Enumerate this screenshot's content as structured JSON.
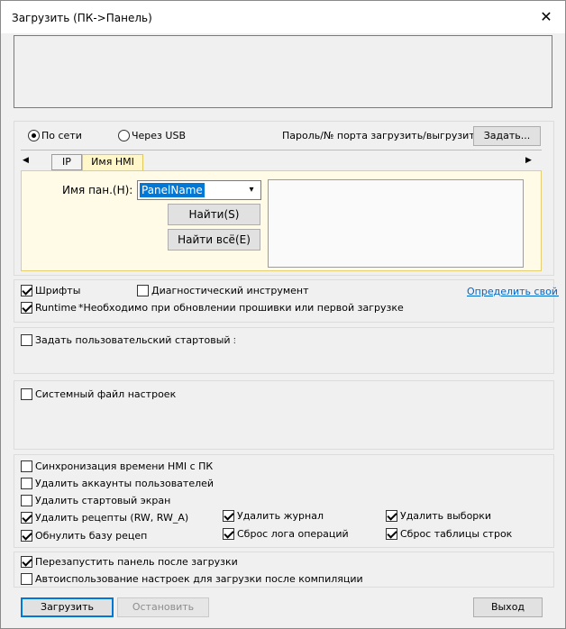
{
  "window": {
    "title": "Загрузить (ПК->Панель)",
    "close_glyph": "✕"
  },
  "connection": {
    "radio_network": "По сети",
    "radio_usb": "Через USB",
    "selected": "network",
    "password_label": "Пароль/№ порта загрузить/выгрузить :",
    "set_button": "Задать..."
  },
  "tabs": {
    "left_arrow": "◀",
    "right_arrow": "▶",
    "items": [
      {
        "label": "IP",
        "active": false
      },
      {
        "label": "Имя HMI",
        "active": true
      }
    ]
  },
  "hmi_tab": {
    "panel_name_label": "Имя пан.(H):",
    "panel_name_value": "PanelName",
    "find_button": "Найти(S)",
    "find_all_button": "Найти всё(E)"
  },
  "options": {
    "fonts": {
      "label": "Шрифты",
      "checked": true
    },
    "diag_tool": {
      "label": "Диагностический инструмент",
      "checked": false
    },
    "define_ip_link": "Определить свой IP",
    "runtime": {
      "label": "Runtime",
      "checked": true
    },
    "runtime_note": "*Необходимо при обновлении прошивки или первой загрузке"
  },
  "start_screen": {
    "label": "Задать пользовательский стартовый экран",
    "checked": false
  },
  "system_file": {
    "label": "Системный файл настроек",
    "checked": false
  },
  "sync": {
    "sync_time": {
      "label": "Синхронизация времени HMI с ПК",
      "checked": false
    },
    "delete_accounts": {
      "label": "Удалить аккаунты пользователей",
      "checked": false
    },
    "delete_start_screen": {
      "label": "Удалить стартовый экран",
      "checked": false
    },
    "delete_recipes": {
      "label": "Удалить рецепты (RW, RW_A)",
      "checked": true
    },
    "delete_journal": {
      "label": "Удалить журнал",
      "checked": true
    },
    "delete_samples": {
      "label": "Удалить выборки",
      "checked": true
    },
    "reset_recipe_db": {
      "label": "Обнулить базу рецептов",
      "checked": true
    },
    "reset_ops_log": {
      "label": "Сброс лога операций",
      "checked": true
    },
    "reset_row_table": {
      "label": "Сброс таблицы строк",
      "checked": true
    }
  },
  "restart": {
    "restart_panel": {
      "label": "Перезапустить панель после загрузки",
      "checked": true
    },
    "auto_use": {
      "label": "Автоиспользование настроек для загрузки после компиляции",
      "checked": false
    }
  },
  "footer": {
    "upload_button": "Загрузить",
    "stop_button": "Остановить",
    "exit_button": "Выход"
  }
}
